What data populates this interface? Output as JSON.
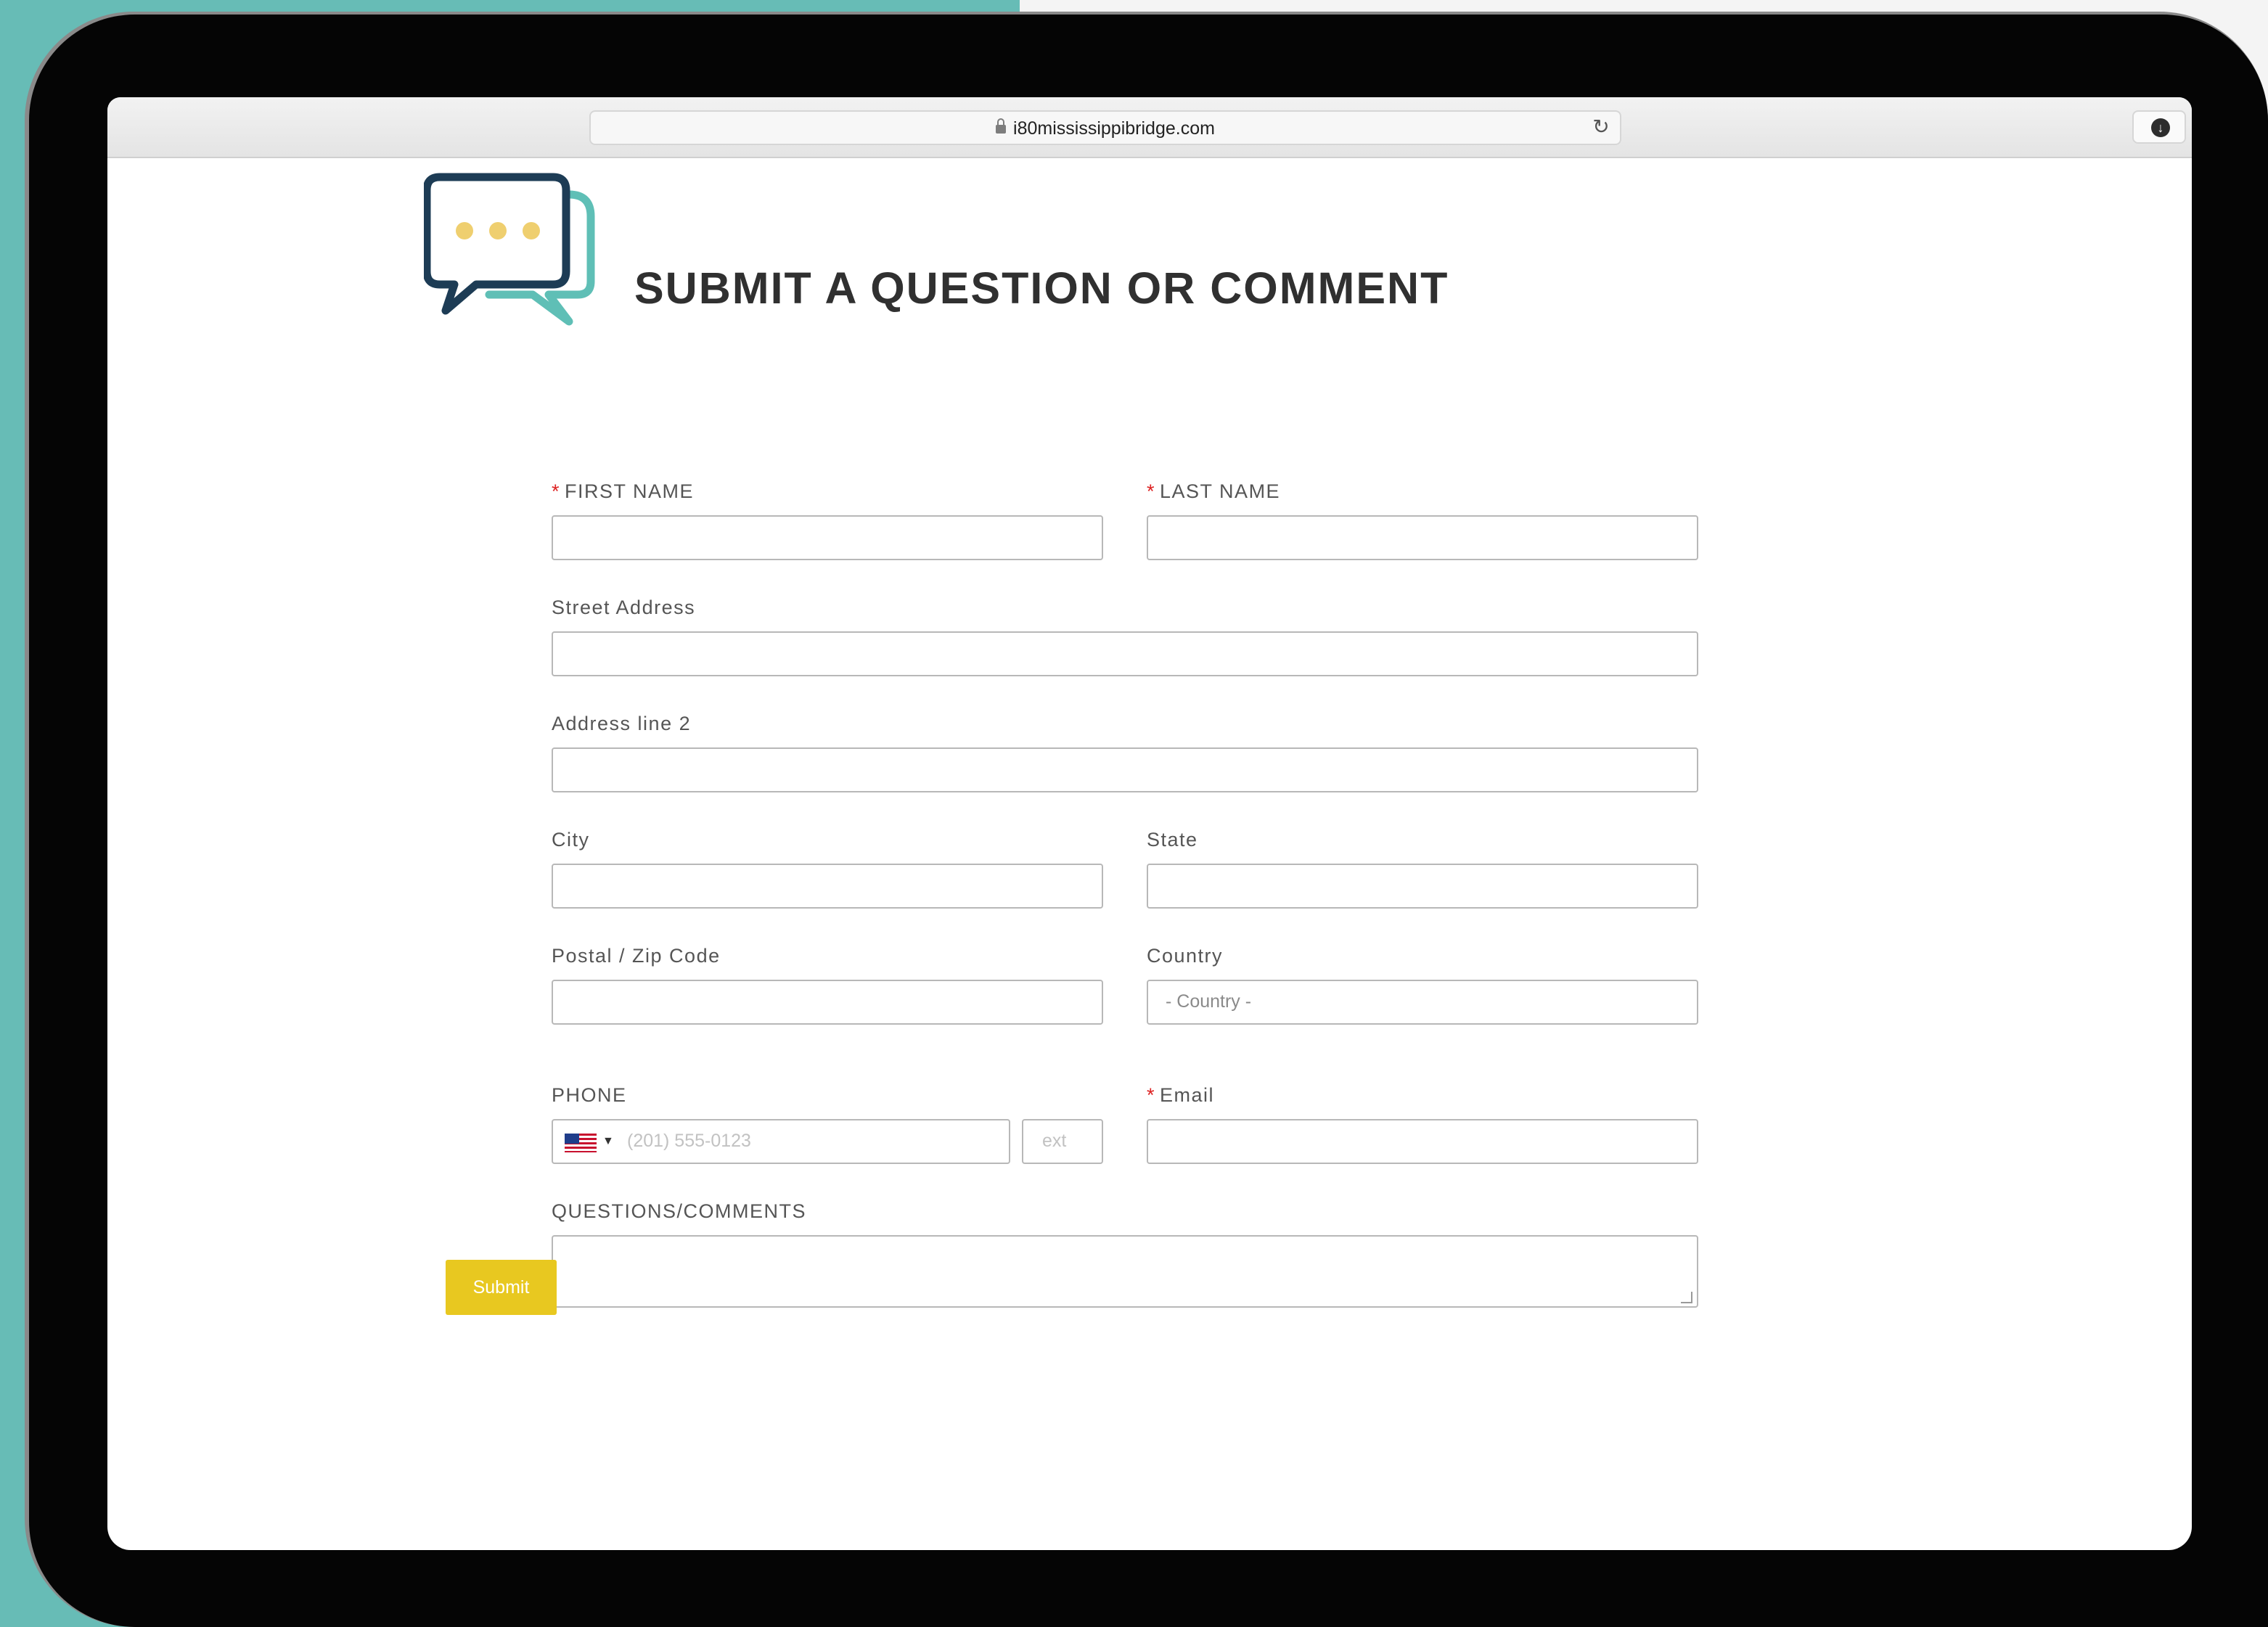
{
  "browser": {
    "url": "i80mississippibridge.com"
  },
  "form": {
    "title": "SUBMIT A QUESTION OR COMMENT",
    "required_marker": "*",
    "fields": {
      "first_name": {
        "label": "FIRST NAME",
        "value": ""
      },
      "last_name": {
        "label": "LAST NAME",
        "value": ""
      },
      "street_address": {
        "label": "Street Address",
        "value": ""
      },
      "address_line_2": {
        "label": "Address line 2",
        "value": ""
      },
      "city": {
        "label": "City",
        "value": ""
      },
      "state": {
        "label": "State",
        "value": ""
      },
      "postal": {
        "label": "Postal / Zip Code",
        "value": ""
      },
      "country": {
        "label": "Country",
        "selected": "- Country -"
      },
      "phone": {
        "label": "PHONE",
        "placeholder": "(201) 555-0123",
        "ext_placeholder": "ext"
      },
      "email": {
        "label": "Email",
        "value": ""
      },
      "comments": {
        "label": "QUESTIONS/COMMENTS",
        "value": ""
      }
    },
    "submit_label": "Submit"
  },
  "colors": {
    "teal_background": "#67bcb6",
    "logo_navy": "#1d3c55",
    "logo_teal": "#5fbfb6",
    "logo_dots": "#efcf6f",
    "submit_yellow": "#e8c820",
    "required_red": "#dd2222"
  },
  "icons": [
    "lock-icon",
    "reload-icon",
    "download-icon",
    "chat-bubbles-icon",
    "us-flag-icon",
    "caret-down-icon",
    "resize-handle-icon"
  ]
}
